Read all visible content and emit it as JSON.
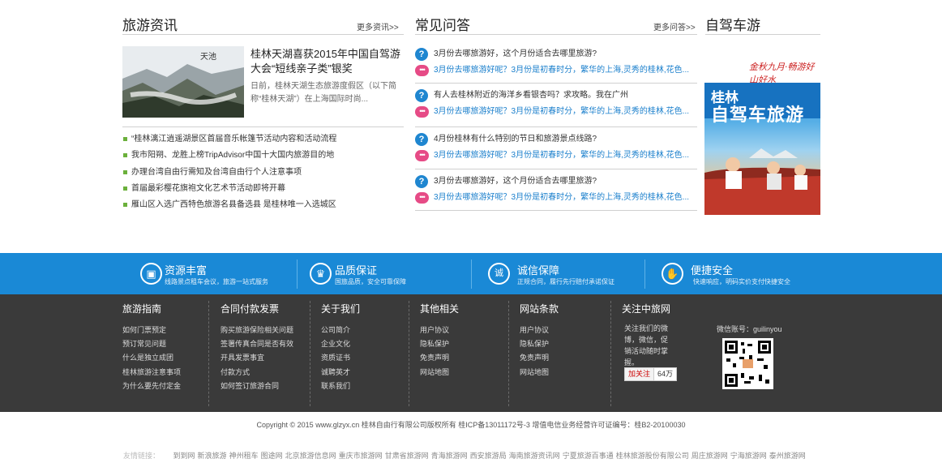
{
  "news": {
    "title": "旅游资讯",
    "more": "更多资讯>>",
    "feature_title": "桂林天湖喜获2015年中国自驾游大会“短线亲子类”银奖",
    "feature_desc": "日前，桂林天湖生态旅游度假区（以下简称“桂林天湖”）在上海国际时尚...",
    "items": [
      "“桂林漓江逍遥湖景区首届音乐帐篷节活动内容和活动流程",
      "我市阳朔、龙胜上榜TripAdvisor中国十大国内旅游目的地",
      "办理台湾自由行需知及台湾自由行个人注意事项",
      "首届最彩樱花旗袍文化艺术节活动即将开幕",
      "雁山区入选广西特色旅游名县备选县 是桂林唯一入选城区"
    ]
  },
  "faq": {
    "title": "常见问答",
    "more": "更多问答>>",
    "q_icon": "?",
    "a_icon": "•••",
    "items": [
      {
        "q": "3月份去哪旅游好，这个月份适合去哪里旅游?",
        "a": "3月份去哪旅游好呢？3月份是初春时分，繁华的上海,灵秀的桂林,花色..."
      },
      {
        "q": "有人去桂林附近的海洋乡看银杏吗？求攻略。我在广州",
        "a": "3月份去哪旅游好呢？3月份是初春时分，繁华的上海,灵秀的桂林,花色..."
      },
      {
        "q": "4月份桂林有什么特别的节日和旅游景点线路?",
        "a": "3月份去哪旅游好呢？3月份是初春时分，繁华的上海,灵秀的桂林,花色..."
      },
      {
        "q": "3月份去哪旅游好，这个月份适合去哪里旅游?",
        "a": "3月份去哪旅游好呢？3月份是初春时分，繁华的上海,灵秀的桂林,花色..."
      }
    ]
  },
  "selfdrive": {
    "title": "自驾车游",
    "ad_slogan": "金秋九月·畅游好山好水",
    "ad_city": "桂林",
    "ad_main": "自驾车旅游"
  },
  "band": [
    {
      "icon": "briefcase-icon",
      "glyph": "▣",
      "title": "资源丰富",
      "desc": "线路景点租车会议，旅游一站式服务"
    },
    {
      "icon": "trophy-icon",
      "glyph": "♛",
      "title": "品质保证",
      "desc": "国旅品质，安全可靠保障"
    },
    {
      "icon": "shield-icon",
      "glyph": "诚",
      "title": "诚信保障",
      "desc": "正规合同，履行先行赔付承诺保证"
    },
    {
      "icon": "handshake-icon",
      "glyph": "✋",
      "title": "便捷安全",
      "desc": "快速响应，明码实价支付快捷安全"
    }
  ],
  "footer": {
    "columns": [
      {
        "title": "旅游指南",
        "links": [
          "如何门票预定",
          "预订常见问题",
          "什么是独立成团",
          "桂林旅游注意事项",
          "为什么要先付定金"
        ]
      },
      {
        "title": "合同付款发票",
        "links": [
          "购买旅游保险相关问题",
          "签署传真合同是否有效",
          "开具发票事宜",
          "付款方式",
          "如何签订旅游合同"
        ]
      },
      {
        "title": "关于我们",
        "links": [
          "公司简介",
          "企业文化",
          "资质证书",
          "诚聘英才",
          "联系我们"
        ]
      },
      {
        "title": "其他相关",
        "links": [
          "用户协议",
          "隐私保护",
          "免责声明",
          "网站地图"
        ]
      },
      {
        "title": "网站条款",
        "links": [
          "用户协议",
          "隐私保护",
          "免责声明",
          "网站地图"
        ]
      }
    ],
    "follow": {
      "title": "关注中旅网",
      "text": "关注我们的微博，微信，促销活动随时掌握。",
      "weibo_label": "加关注",
      "weibo_count": "64万",
      "wechat_label": "微信账号：guilinyou"
    }
  },
  "copyright": "Copyright © 2015 www.glzyx.cn  桂林自由行有限公司版权所有    桂ICP备13011172号-3    增值电信业务经营许可证编号：桂B2-20100030",
  "friend_links": {
    "label": "友情链接：",
    "links": [
      "到到网",
      "新浪旅游",
      "神州租车",
      "图途网",
      "北京旅游信息网",
      "重庆市旅游网",
      "甘肃省旅游网",
      "青海旅游网",
      "西安旅游局",
      "海南旅游资讯网",
      "宁夏旅游百事通",
      "桂林旅游股份有限公司",
      "周庄旅游网",
      "宁海旅游网",
      "泰州旅游网"
    ]
  }
}
